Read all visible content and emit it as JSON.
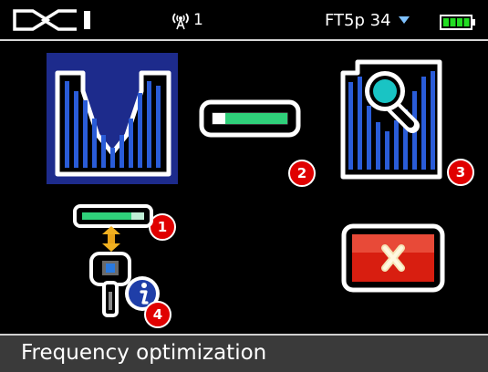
{
  "status_bar": {
    "logo_icon": "dci-logo",
    "signal_icon": "antenna-signal-icon",
    "signal_count": "1",
    "mode_label": "FT5p 34",
    "mode_dropdown_icon": "triangle-down-icon",
    "battery_icon": "battery-full-icon"
  },
  "menu": {
    "items": [
      {
        "id": "item-1",
        "icon": "frequency-optimization-spectrum-icon",
        "badge": "1",
        "selected": true
      },
      {
        "id": "item-2",
        "icon": "signal-strength-bar-icon",
        "badge": "2"
      },
      {
        "id": "item-3",
        "icon": "spectrum-search-magnifier-icon",
        "badge": "3"
      },
      {
        "id": "item-4",
        "icon": "transmitter-pairing-info-icon",
        "badge": "4"
      }
    ],
    "exit": {
      "icon": "close-x-icon"
    }
  },
  "footer": {
    "title": "Frequency optimization"
  },
  "colors": {
    "background": "#000000",
    "selection": "#1d2b8c",
    "bars": "#2a5cd8",
    "badge": "#e00000",
    "signal_green": "#2fd07a",
    "exit_red": "#d81e10",
    "footer": "#3a3a3a"
  }
}
